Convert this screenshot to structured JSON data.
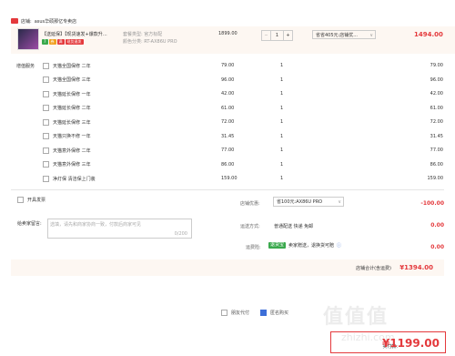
{
  "store": {
    "prefix": "店铺:",
    "name": "asus华硕那亿专卖店"
  },
  "product": {
    "name": "【送延保】【现货速发+爆款升…",
    "tags": [
      {
        "text": "7",
        "color": "#3aa94d"
      },
      {
        "text": "券",
        "color": "#f0a020"
      },
      {
        "text": "满",
        "color": "#e4393c"
      },
      {
        "text": "现货速发",
        "color": "#e4393c"
      }
    ],
    "spec_lines": [
      "套餐类型: 官方标配",
      "颜色分类: RT-AX86U PRO"
    ],
    "price": "1899.00",
    "qty": "1",
    "qty_minus": "−",
    "qty_plus": "+",
    "promo": "省省405元:店铺优...",
    "promo_caret": "∨",
    "total": "1494.00"
  },
  "services": {
    "label": "增值服务",
    "items": [
      {
        "name": "天猫全国保修 二年",
        "price": "79.00",
        "qty": "1",
        "total": "79.00"
      },
      {
        "name": "天猫全国保修 三年",
        "price": "96.00",
        "qty": "1",
        "total": "96.00"
      },
      {
        "name": "天猫延长保修 一年",
        "price": "42.00",
        "qty": "1",
        "total": "42.00"
      },
      {
        "name": "天猫延长保修 二年",
        "price": "61.00",
        "qty": "1",
        "total": "61.00"
      },
      {
        "name": "天猫延长保修 三年",
        "price": "72.00",
        "qty": "1",
        "total": "72.00"
      },
      {
        "name": "天猫只换不修 一年",
        "price": "31.45",
        "qty": "1",
        "total": "31.45"
      },
      {
        "name": "天猫意外保修 二年",
        "price": "77.00",
        "qty": "1",
        "total": "77.00"
      },
      {
        "name": "天猫意外保修 三年",
        "price": "86.00",
        "qty": "1",
        "total": "86.00"
      },
      {
        "name": "净灯保 清洁保上门装",
        "price": "159.00",
        "qty": "1",
        "total": "159.00"
      }
    ]
  },
  "invoice": {
    "label": "开具发票"
  },
  "note": {
    "label": "给卖家留言:",
    "placeholder": "选填，请先和商家协商一致，付款后商家可见",
    "counter": "0/200"
  },
  "shipping": {
    "label": "店铺优惠:",
    "select": "省100元:AX86U PRO",
    "caret": "∨",
    "value": "-100.00"
  },
  "delivery": {
    "label": "运送方式:",
    "text": "普通配送 快递 免邮",
    "value": "0.00"
  },
  "insurance": {
    "label": "运费险:",
    "badge": "退货宝",
    "text": "卖家赠送，退换货可赔",
    "value": "0.00"
  },
  "store_total": {
    "label": "店铺合计(含运费)",
    "value": "¥1394.00"
  },
  "bottom_options": [
    {
      "label": "朋友代付",
      "checked": false
    },
    {
      "label": "匿名购买",
      "checked": true
    }
  ],
  "payment": {
    "label": "实付款:",
    "amount": "¥1199.00"
  },
  "watermark": {
    "main": "值值值",
    "sub": "zhizhi.com"
  },
  "colors": {
    "accent": "#e4393c",
    "checkbox": "#3d6fd8",
    "highlight_bg": "#fdf7f2"
  }
}
